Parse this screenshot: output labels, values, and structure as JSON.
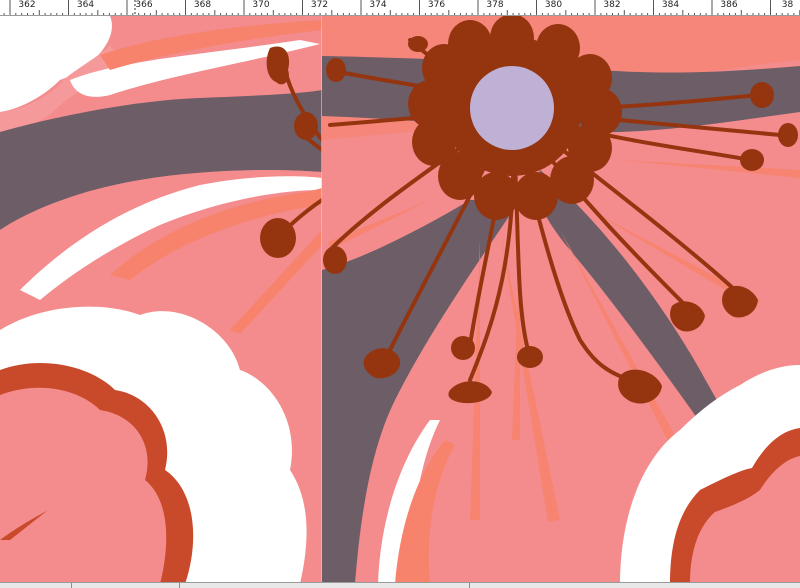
{
  "ruler": {
    "unit_step": 2,
    "labels": [
      "362",
      "364",
      "366",
      "368",
      "370",
      "372",
      "374",
      "376",
      "378",
      "380",
      "382",
      "384",
      "386",
      "38"
    ]
  },
  "artwork": {
    "name": "flower-illustration",
    "colors": {
      "background_pink": "#f48b8d",
      "light_pink": "#f5999b",
      "salmon": "#f7836c",
      "slate": "#6c5d67",
      "white": "#ffffff",
      "rust": "#c94a2a",
      "dark_rust": "#953510",
      "center_lavender": "#bfb0d6"
    }
  },
  "statusbar": {
    "visible": true
  }
}
